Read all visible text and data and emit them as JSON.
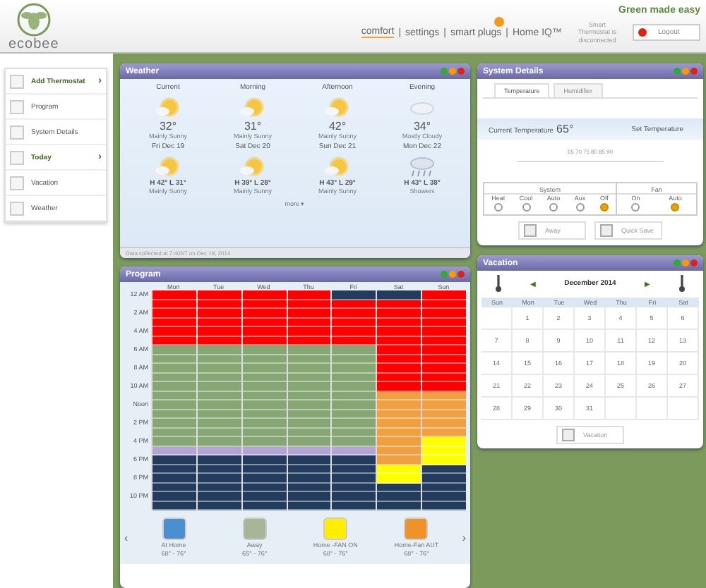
{
  "header": {
    "logo": "ecobee",
    "tagline": "Green made easy",
    "separator": "|",
    "nav": [
      {
        "label": "comfort",
        "selected": true,
        "badge": false
      },
      {
        "label": "settings",
        "selected": false,
        "badge": false
      },
      {
        "label": "smart plugs",
        "selected": false,
        "badge": true
      },
      {
        "label": "Home IQ™",
        "selected": false,
        "badge": false
      }
    ],
    "status": "Smart Thermostat is disconnected",
    "logout": "Logout"
  },
  "sidebar": {
    "items": [
      {
        "label": "Add Thermostat",
        "arrow": "›"
      },
      {
        "label": "Program"
      },
      {
        "label": "System Details"
      },
      {
        "label": "Today",
        "arrow": "›"
      },
      {
        "label": "Vacation"
      },
      {
        "label": "Weather"
      }
    ]
  },
  "weather": {
    "title": "Weather",
    "today": [
      {
        "label": "Current",
        "temp": "32°",
        "summary": "Mainly Sunny",
        "kind": "sun"
      },
      {
        "label": "Morning",
        "temp": "31°",
        "summary": "Mainly Sunny",
        "kind": "sun"
      },
      {
        "label": "Afternoon",
        "temp": "42°",
        "summary": "Mainly Sunny",
        "kind": "sun"
      },
      {
        "label": "Evening",
        "temp": "34°",
        "summary": "Mostly Cloudy",
        "kind": "cloud"
      }
    ],
    "forecast": [
      {
        "label": "Fri Dec 19",
        "temp": "H 42° L 31°",
        "summary": "Mainly Sunny",
        "kind": "sun"
      },
      {
        "label": "Sat Dec 20",
        "temp": "H 39° L 28°",
        "summary": "Mainly Sunny",
        "kind": "sun"
      },
      {
        "label": "Sun Dec 21",
        "temp": "H 43° L 29°",
        "summary": "Mainly Sunny",
        "kind": "sun"
      },
      {
        "label": "Mon Dec 22",
        "temp": "H 43° L 38°",
        "summary": "Showers",
        "kind": "rain"
      }
    ],
    "more": "more ▾",
    "footer": "Data collected at 7:40ST on Dec 19, 2014"
  },
  "program": {
    "title": "Program",
    "days": [
      "Mon",
      "Tue",
      "Wed",
      "Thu",
      "Fri",
      "Sat",
      "Sun"
    ],
    "times": [
      "12 AM",
      "2 AM",
      "4 AM",
      "6 AM",
      "8 AM",
      "10 AM",
      "Noon",
      "2 PM",
      "4 PM",
      "6 PM",
      "8 PM",
      "10 PM"
    ],
    "schedule": [
      {
        "hours": [
          {
            "color": "#ff0000"
          },
          {
            "color": "#ff0000"
          },
          {
            "color": "#ff0000"
          },
          {
            "color": "#ff0000"
          },
          {
            "color": "#ff0000"
          },
          {
            "color": "#ff0000"
          },
          {
            "color": "#86a673"
          },
          {
            "color": "#86a673"
          },
          {
            "color": "#86a673"
          },
          {
            "color": "#86a673"
          },
          {
            "color": "#86a673"
          },
          {
            "color": "#86a673"
          },
          {
            "color": "#86a673"
          },
          {
            "color": "#86a673"
          },
          {
            "color": "#86a673"
          },
          {
            "color": "#86a673"
          },
          {
            "color": "#86a673"
          },
          {
            "color": "#b3a3d6"
          },
          {
            "color": "#233c5e"
          },
          {
            "color": "#233c5e"
          },
          {
            "color": "#233c5e"
          },
          {
            "color": "#233c5e"
          },
          {
            "color": "#233c5e"
          },
          {
            "color": "#233c5e"
          }
        ]
      },
      {
        "hours": [
          {
            "color": "#ff0000"
          },
          {
            "color": "#ff0000"
          },
          {
            "color": "#ff0000"
          },
          {
            "color": "#ff0000"
          },
          {
            "color": "#ff0000"
          },
          {
            "color": "#ff0000"
          },
          {
            "color": "#86a673"
          },
          {
            "color": "#86a673"
          },
          {
            "color": "#86a673"
          },
          {
            "color": "#86a673"
          },
          {
            "color": "#86a673"
          },
          {
            "color": "#86a673"
          },
          {
            "color": "#86a673"
          },
          {
            "color": "#86a673"
          },
          {
            "color": "#86a673"
          },
          {
            "color": "#86a673"
          },
          {
            "color": "#86a673"
          },
          {
            "color": "#b3a3d6"
          },
          {
            "color": "#233c5e"
          },
          {
            "color": "#233c5e"
          },
          {
            "color": "#233c5e"
          },
          {
            "color": "#233c5e"
          },
          {
            "color": "#233c5e"
          },
          {
            "color": "#233c5e"
          }
        ]
      },
      {
        "hours": [
          {
            "color": "#ff0000"
          },
          {
            "color": "#ff0000"
          },
          {
            "color": "#ff0000"
          },
          {
            "color": "#ff0000"
          },
          {
            "color": "#ff0000"
          },
          {
            "color": "#ff0000"
          },
          {
            "color": "#86a673"
          },
          {
            "color": "#86a673"
          },
          {
            "color": "#86a673"
          },
          {
            "color": "#86a673"
          },
          {
            "color": "#86a673"
          },
          {
            "color": "#86a673"
          },
          {
            "color": "#86a673"
          },
          {
            "color": "#86a673"
          },
          {
            "color": "#86a673"
          },
          {
            "color": "#86a673"
          },
          {
            "color": "#86a673"
          },
          {
            "color": "#b3a3d6"
          },
          {
            "color": "#233c5e"
          },
          {
            "color": "#233c5e"
          },
          {
            "color": "#233c5e"
          },
          {
            "color": "#233c5e"
          },
          {
            "color": "#233c5e"
          },
          {
            "color": "#233c5e"
          }
        ]
      },
      {
        "hours": [
          {
            "color": "#ff0000"
          },
          {
            "color": "#ff0000"
          },
          {
            "color": "#ff0000"
          },
          {
            "color": "#ff0000"
          },
          {
            "color": "#ff0000"
          },
          {
            "color": "#ff0000"
          },
          {
            "color": "#86a673"
          },
          {
            "color": "#86a673"
          },
          {
            "color": "#86a673"
          },
          {
            "color": "#86a673"
          },
          {
            "color": "#86a673"
          },
          {
            "color": "#86a673"
          },
          {
            "color": "#86a673"
          },
          {
            "color": "#86a673"
          },
          {
            "color": "#86a673"
          },
          {
            "color": "#86a673"
          },
          {
            "color": "#86a673"
          },
          {
            "color": "#b3a3d6"
          },
          {
            "color": "#233c5e"
          },
          {
            "color": "#233c5e"
          },
          {
            "color": "#233c5e"
          },
          {
            "color": "#233c5e"
          },
          {
            "color": "#233c5e"
          },
          {
            "color": "#233c5e"
          }
        ]
      },
      {
        "hours": [
          {
            "color": "#233c5e"
          },
          {
            "color": "#ff0000"
          },
          {
            "color": "#ff0000"
          },
          {
            "color": "#ff0000"
          },
          {
            "color": "#ff0000"
          },
          {
            "color": "#ff0000"
          },
          {
            "color": "#86a673"
          },
          {
            "color": "#86a673"
          },
          {
            "color": "#86a673"
          },
          {
            "color": "#86a673"
          },
          {
            "color": "#86a673"
          },
          {
            "color": "#86a673"
          },
          {
            "color": "#86a673"
          },
          {
            "color": "#86a673"
          },
          {
            "color": "#86a673"
          },
          {
            "color": "#86a673"
          },
          {
            "color": "#86a673"
          },
          {
            "color": "#b3a3d6"
          },
          {
            "color": "#233c5e"
          },
          {
            "color": "#233c5e"
          },
          {
            "color": "#233c5e"
          },
          {
            "color": "#233c5e"
          },
          {
            "color": "#233c5e"
          },
          {
            "color": "#233c5e"
          }
        ]
      },
      {
        "hours": [
          {
            "color": "#233c5e"
          },
          {
            "color": "#ff0000"
          },
          {
            "color": "#ff0000"
          },
          {
            "color": "#ff0000"
          },
          {
            "color": "#ff0000"
          },
          {
            "color": "#ff0000"
          },
          {
            "color": "#ff0000"
          },
          {
            "color": "#ff0000"
          },
          {
            "color": "#ff0000"
          },
          {
            "color": "#ff0000"
          },
          {
            "color": "#ff0000"
          },
          {
            "color": "#f0a040"
          },
          {
            "color": "#f0a040"
          },
          {
            "color": "#f0a040"
          },
          {
            "color": "#f0a040"
          },
          {
            "color": "#f0a040"
          },
          {
            "color": "#f0a040"
          },
          {
            "color": "#f0a040"
          },
          {
            "color": "#f0a040"
          },
          {
            "color": "#ffff00"
          },
          {
            "color": "#ffff00"
          },
          {
            "color": "#233c5e"
          },
          {
            "color": "#233c5e"
          },
          {
            "color": "#233c5e"
          }
        ]
      },
      {
        "hours": [
          {
            "color": "#ff0000"
          },
          {
            "color": "#ff0000"
          },
          {
            "color": "#ff0000"
          },
          {
            "color": "#ff0000"
          },
          {
            "color": "#ff0000"
          },
          {
            "color": "#ff0000"
          },
          {
            "color": "#ff0000"
          },
          {
            "color": "#ff0000"
          },
          {
            "color": "#ff0000"
          },
          {
            "color": "#ff0000"
          },
          {
            "color": "#ff0000"
          },
          {
            "color": "#f0a040"
          },
          {
            "color": "#f0a040"
          },
          {
            "color": "#f0a040"
          },
          {
            "color": "#f0a040"
          },
          {
            "color": "#f0a040"
          },
          {
            "color": "#ffff00"
          },
          {
            "color": "#ffff00"
          },
          {
            "color": "#ffff00"
          },
          {
            "color": "#233c5e"
          },
          {
            "color": "#233c5e"
          },
          {
            "color": "#233c5e"
          },
          {
            "color": "#233c5e"
          },
          {
            "color": "#233c5e"
          }
        ]
      }
    ],
    "prev": "‹",
    "next": "›",
    "settings": [
      {
        "name": "At Home",
        "range": "68° - 76°",
        "color": "#4a8fd0"
      },
      {
        "name": "Away",
        "range": "65° - 76°",
        "color": "#a7b598"
      },
      {
        "name": "Home -FAN ON",
        "range": "68° - 76°",
        "color": "#ffee00"
      },
      {
        "name": "Home-Fan AUT",
        "range": "68° - 76°",
        "color": "#f0922a"
      }
    ]
  },
  "system": {
    "title": "System Details",
    "tabs": [
      {
        "label": "Temperature",
        "selected": true
      },
      {
        "label": "Humidifier",
        "selected": false
      }
    ],
    "current_label": "Current Temperature",
    "current": "65°",
    "set_label": "Set Temperature",
    "scale": [
      "65",
      "70",
      "75",
      "80",
      "85",
      "90"
    ],
    "system_label": "System",
    "modes": [
      {
        "label": "Heat",
        "selected": false
      },
      {
        "label": "Cool",
        "selected": false
      },
      {
        "label": "Auto",
        "selected": false
      },
      {
        "label": "Aux",
        "selected": false
      },
      {
        "label": "Off",
        "selected": true
      }
    ],
    "fan_label": "Fan",
    "fan": [
      {
        "label": "On",
        "selected": false
      },
      {
        "label": "Auto",
        "selected": true
      }
    ],
    "buttons": [
      "Away",
      "Quick Save"
    ]
  },
  "vacation": {
    "title": "Vacation",
    "month": "December 2014",
    "prev": "◀",
    "next": "▶",
    "weekdays": [
      "Sun",
      "Mon",
      "Tue",
      "Wed",
      "Thu",
      "Fri",
      "Sat"
    ],
    "weeks": [
      {
        "kind": "first",
        "days": [
          "1",
          "2",
          "3",
          "4",
          "5",
          "6"
        ]
      },
      {
        "kind": "full",
        "days": [
          "7",
          "8",
          "9",
          "10",
          "11",
          "12",
          "13"
        ]
      },
      {
        "kind": "full",
        "days": [
          "14",
          "15",
          "16",
          "17",
          "18",
          "19",
          "20"
        ]
      },
      {
        "kind": "full",
        "days": [
          "21",
          "22",
          "23",
          "24",
          "25",
          "26",
          "27"
        ]
      },
      {
        "kind": "last",
        "days": [
          "28",
          "29",
          "30",
          "31"
        ]
      }
    ],
    "button": "Vacation"
  }
}
